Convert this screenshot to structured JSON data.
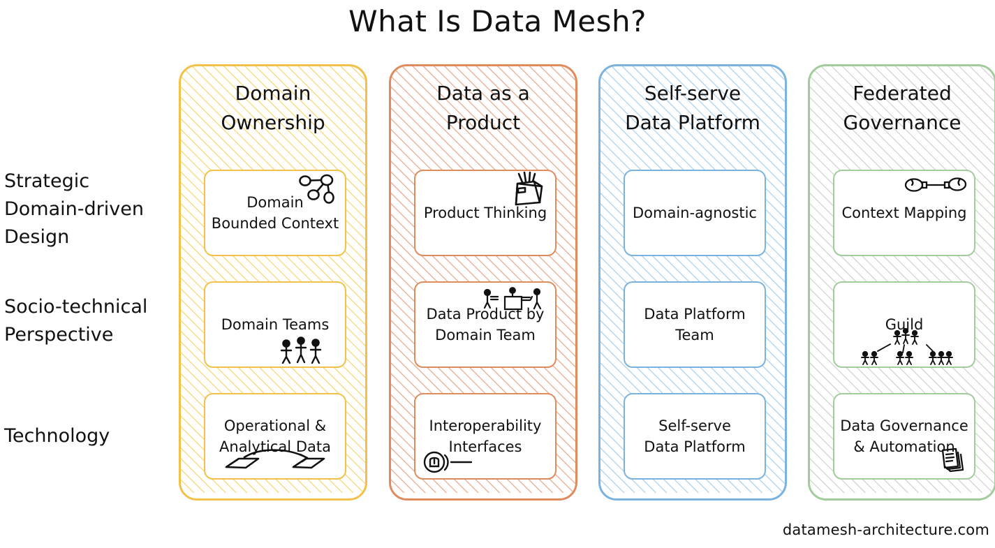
{
  "title": "What Is Data Mesh?",
  "footer": "datamesh-architecture.com",
  "rows": [
    {
      "label": "Strategic\nDomain-driven\nDesign"
    },
    {
      "label": "Socio-technical\nPerspective"
    },
    {
      "label": "Technology"
    }
  ],
  "columns": [
    {
      "header": "Domain\nOwnership",
      "accent": "#f2c14a",
      "hatch": "#f6d46b",
      "cards": [
        {
          "label": "Domain\nBounded Context",
          "icon": "node-graph-icon"
        },
        {
          "label": "Domain Teams",
          "icon": "three-people-icon"
        },
        {
          "label": "Operational &\nAnalytical Data",
          "icon": "data-flow-arrow-icon"
        }
      ]
    },
    {
      "header": "Data as a\nProduct",
      "accent": "#e08b5d",
      "hatch": "#e9a383",
      "cards": [
        {
          "label": "Product Thinking",
          "icon": "gift-box-icon"
        },
        {
          "label": "Data Product by\nDomain Team",
          "icon": "team-meeting-icon"
        },
        {
          "label": "Interoperability\nInterfaces",
          "icon": "plug-socket-icon"
        }
      ]
    },
    {
      "header": "Self-serve\nData Platform",
      "accent": "#7ab3e0",
      "hatch": "#a9cdeb",
      "cards": [
        {
          "label": "Domain-agnostic",
          "icon": ""
        },
        {
          "label": "Data Platform\nTeam",
          "icon": ""
        },
        {
          "label": "Self-serve\nData Platform",
          "icon": ""
        }
      ]
    },
    {
      "header": "Federated\nGovernance",
      "accent": "#a2cc9c",
      "hatch": "#cfcfcf",
      "cards": [
        {
          "label": "Context Mapping",
          "icon": "context-link-icon"
        },
        {
          "label": "Guild",
          "icon": "guild-hierarchy-icon"
        },
        {
          "label": "Data Governance\n& Automation",
          "icon": "documents-icon"
        }
      ]
    }
  ]
}
